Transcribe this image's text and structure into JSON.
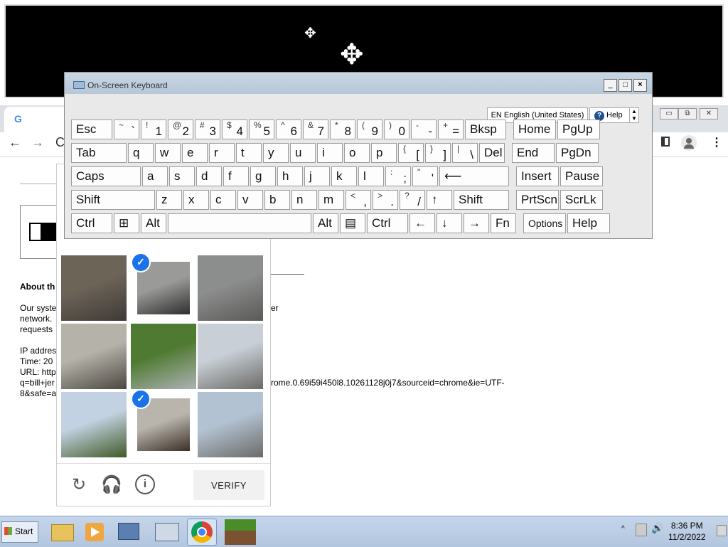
{
  "osk": {
    "title": "On-Screen Keyboard",
    "language": "EN English (United States)",
    "help": "Help",
    "min": "_",
    "max": "□",
    "close": "×",
    "rows": [
      [
        {
          "m": "Esc",
          "w": 60
        },
        {
          "s": "~",
          "m": "`",
          "w": 38
        },
        {
          "s": "!",
          "m": "1",
          "w": 38
        },
        {
          "s": "@",
          "m": "2",
          "w": 38
        },
        {
          "s": "#",
          "m": "3",
          "w": 38
        },
        {
          "s": "$",
          "m": "4",
          "w": 38
        },
        {
          "s": "%",
          "m": "5",
          "w": 38
        },
        {
          "s": "^",
          "m": "6",
          "w": 38
        },
        {
          "s": "&",
          "m": "7",
          "w": 38
        },
        {
          "s": "*",
          "m": "8",
          "w": 38
        },
        {
          "s": "(",
          "m": "9",
          "w": 38
        },
        {
          "s": ")",
          "m": "0",
          "w": 38
        },
        {
          "s": "-",
          "m": "-",
          "w": 38
        },
        {
          "s": "+",
          "m": "=",
          "w": 38
        },
        {
          "m": "Bksp",
          "w": 60
        },
        {
          "m": "Home",
          "w": 62,
          "gap": 8
        },
        {
          "m": "PgUp",
          "w": 62
        }
      ],
      [
        {
          "m": "Tab",
          "w": 80
        },
        {
          "m": "q",
          "w": 38
        },
        {
          "m": "w",
          "w": 38
        },
        {
          "m": "e",
          "w": 38
        },
        {
          "m": "r",
          "w": 38
        },
        {
          "m": "t",
          "w": 38
        },
        {
          "m": "y",
          "w": 38
        },
        {
          "m": "u",
          "w": 38
        },
        {
          "m": "i",
          "w": 38
        },
        {
          "m": "o",
          "w": 38
        },
        {
          "m": "p",
          "w": 38
        },
        {
          "s": "{",
          "m": "[",
          "w": 38
        },
        {
          "s": "}",
          "m": "]",
          "w": 38
        },
        {
          "s": "|",
          "m": "\\",
          "w": 38
        },
        {
          "m": "Del",
          "w": 38
        },
        {
          "m": "End",
          "w": 62,
          "gap": 8
        },
        {
          "m": "PgDn",
          "w": 62
        }
      ],
      [
        {
          "m": "Caps",
          "w": 100
        },
        {
          "m": "a",
          "w": 38
        },
        {
          "m": "s",
          "w": 38
        },
        {
          "m": "d",
          "w": 38
        },
        {
          "m": "f",
          "w": 38
        },
        {
          "m": "g",
          "w": 38
        },
        {
          "m": "h",
          "w": 38
        },
        {
          "m": "j",
          "w": 38
        },
        {
          "m": "k",
          "w": 38
        },
        {
          "m": "l",
          "w": 38
        },
        {
          "s": ":",
          "m": ";",
          "w": 38
        },
        {
          "s": "\"",
          "m": "'",
          "w": 38
        },
        {
          "m": "⟵",
          "w": 100
        },
        {
          "m": "Insert",
          "w": 62,
          "gap": 8
        },
        {
          "m": "Pause",
          "w": 62
        }
      ],
      [
        {
          "m": "Shift",
          "w": 120
        },
        {
          "m": "z",
          "w": 38
        },
        {
          "m": "x",
          "w": 38
        },
        {
          "m": "c",
          "w": 38
        },
        {
          "m": "v",
          "w": 38
        },
        {
          "m": "b",
          "w": 38
        },
        {
          "m": "n",
          "w": 38
        },
        {
          "m": "m",
          "w": 38
        },
        {
          "s": "<",
          "m": ",",
          "w": 38
        },
        {
          "s": ">",
          "m": ".",
          "w": 38
        },
        {
          "s": "?",
          "m": "/",
          "w": 38
        },
        {
          "m": "↑",
          "w": 38
        },
        {
          "m": "Shift",
          "w": 80
        },
        {
          "m": "PrtScn",
          "w": 62,
          "gap": 8
        },
        {
          "m": "ScrLk",
          "w": 62
        }
      ],
      [
        {
          "m": "Ctrl",
          "w": 60
        },
        {
          "m": "⊞",
          "w": 38
        },
        {
          "m": "Alt",
          "w": 38
        },
        {
          "m": "",
          "w": 204
        },
        {
          "m": "Alt",
          "w": 38
        },
        {
          "m": "▤",
          "w": 38
        },
        {
          "m": "Ctrl",
          "w": 60
        },
        {
          "m": "←",
          "w": 38
        },
        {
          "m": "↓",
          "w": 38
        },
        {
          "m": "→",
          "w": 38
        },
        {
          "m": "Fn",
          "w": 38
        },
        {
          "m": "Options",
          "w": 62,
          "gap": 8,
          "small": true
        },
        {
          "m": "Help",
          "w": 62
        }
      ]
    ]
  },
  "page": {
    "about_heading": "About th",
    "body_line1": "Our syste",
    "body_line2": "network.",
    "body_line3": "requests",
    "body_trailing": "er",
    "ip_label": "IP addres",
    "time_label": "Time: 20",
    "url_label": "URL: http",
    "url_cont1": "q=bill+jer",
    "url_cont2": "8&safe=a",
    "url_tail": "rome.0.69i59i450l8.10261128j0j7&sourceid=chrome&ie=UTF-"
  },
  "captcha": {
    "verify": "VERIFY",
    "tiles": [
      {
        "name": "street-scooters",
        "sel": false,
        "c1": "#6d6458",
        "c2": "#3e3a36"
      },
      {
        "name": "motorcycle",
        "sel": true,
        "c1": "#9a9a98",
        "c2": "#2e2e2e"
      },
      {
        "name": "sky-rooftop",
        "sel": false,
        "c1": "#8c8d8d",
        "c2": "#5a5a57"
      },
      {
        "name": "bridge",
        "sel": false,
        "c1": "#b5b2aa",
        "c2": "#4b4740"
      },
      {
        "name": "car-grass",
        "sel": false,
        "c1": "#4f7a32",
        "c2": "#aeb2b5"
      },
      {
        "name": "city-street",
        "sel": false,
        "c1": "#c8cfd6",
        "c2": "#6b6a66"
      },
      {
        "name": "palm-tree",
        "sel": false,
        "c1": "#c2d2e2",
        "c2": "#3f5a27"
      },
      {
        "name": "motorcycle-rider",
        "sel": true,
        "c1": "#b9b5ad",
        "c2": "#3b2e26"
      },
      {
        "name": "traffic-light",
        "sel": false,
        "c1": "#b3c2d2",
        "c2": "#6b6b68"
      }
    ]
  },
  "taskbar": {
    "start": "Start",
    "time": "8:36 PM",
    "date": "11/2/2022"
  }
}
